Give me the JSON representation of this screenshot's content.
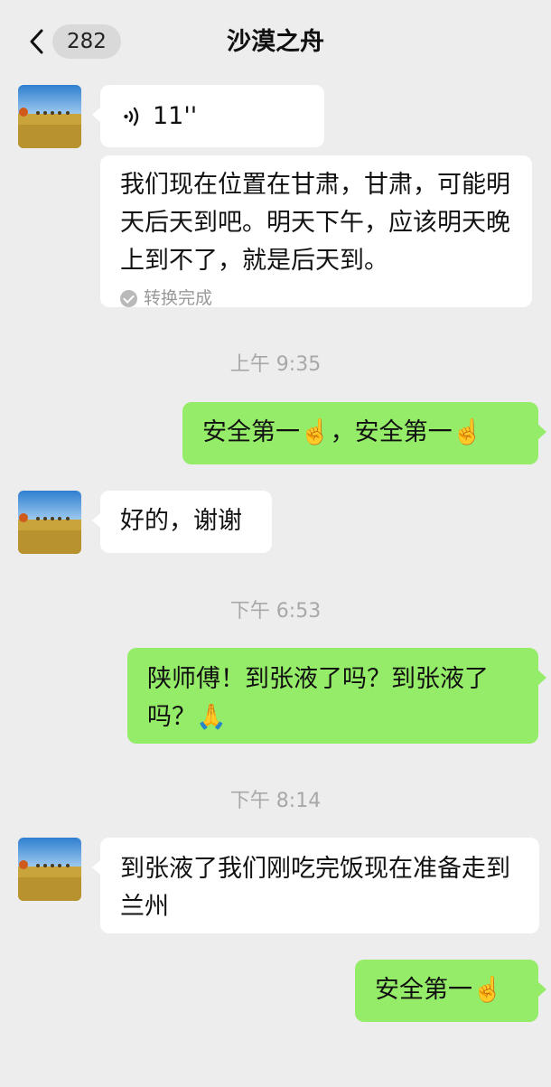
{
  "header": {
    "unread_count": "282",
    "title": "沙漠之舟"
  },
  "messages": {
    "m1_voice_duration": "11''",
    "m2_text": "我们现在位置在甘肃，甘肃，可能明天后天到吧。明天下午，应该明天晚上到不了，就是后天到。",
    "m2_status": "转换完成",
    "time1": "上午 9:35",
    "m3_text": "安全第一☝️，安全第一☝️",
    "m4_text": "好的，谢谢",
    "time2": "下午 6:53",
    "m5_text": "陕师傅！到张液了吗？到张液了吗？🙏",
    "time3": "下午 8:14",
    "m6_text": "到张液了我们刚吃完饭现在准备走到兰州",
    "m7_text": "安全第一☝️"
  },
  "icons": {
    "back": "chevron-left-icon",
    "voice": "voice-wave-icon",
    "status": "check-circle-icon"
  },
  "colors": {
    "background": "#ededed",
    "incoming_bubble": "#ffffff",
    "outgoing_bubble": "#95ec69",
    "timestamp": "#a8a8a8"
  }
}
